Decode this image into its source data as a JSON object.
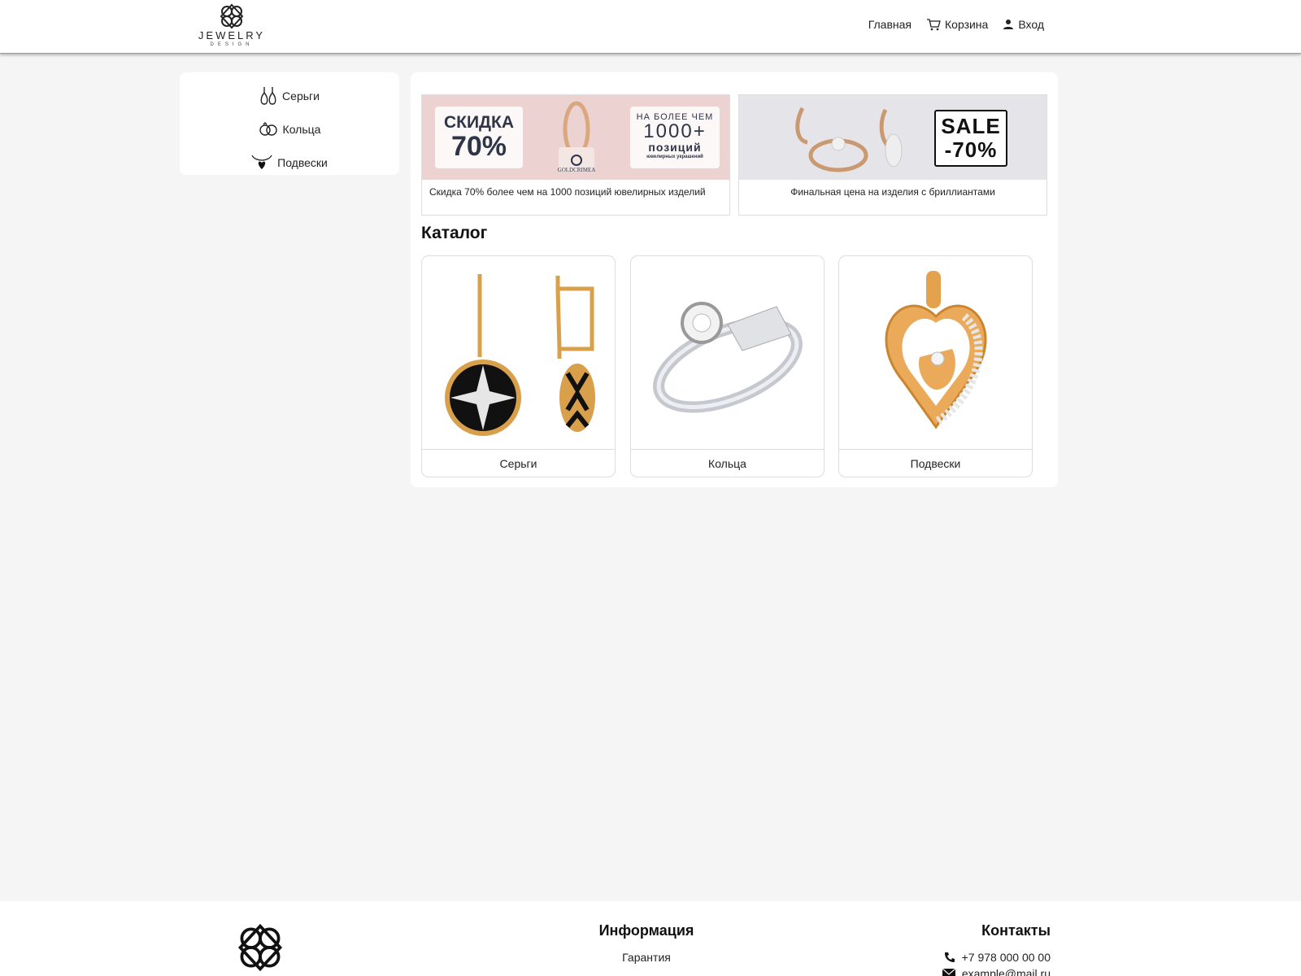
{
  "brand": {
    "name": "JEWELRY",
    "sub": "DESIGN"
  },
  "nav": {
    "home": "Главная",
    "cart": "Корзина",
    "login": "Вход"
  },
  "sidebar": {
    "items": [
      {
        "label": "Серьги",
        "icon": "earrings-icon"
      },
      {
        "label": "Кольца",
        "icon": "rings-icon"
      },
      {
        "label": "Подвески",
        "icon": "pendant-icon"
      }
    ]
  },
  "banners": [
    {
      "caption": "Скидка 70% более чем на 1000 позиций ювелирных изделий",
      "promo_left_1": "СКИДКА",
      "promo_left_2": "70%",
      "promo_right_1": "НА БОЛЕЕ ЧЕМ",
      "promo_right_2": "1000+",
      "promo_right_3": "позиций",
      "promo_right_4": "ювелирных украшений",
      "brand": "GOLDCRIMEA"
    },
    {
      "caption": "Финальная цена на изделия с бриллиантами",
      "sale_1": "SALE",
      "sale_2": "-70%"
    }
  ],
  "catalog": {
    "title": "Каталог",
    "cards": [
      {
        "label": "Серьги"
      },
      {
        "label": "Кольца"
      },
      {
        "label": "Подвески"
      }
    ]
  },
  "footer": {
    "info_title": "Информация",
    "info_links": [
      "Гарантия"
    ],
    "contacts_title": "Контакты",
    "phone": "+7 978 000 00 00",
    "email": "example@mail.ru"
  },
  "colors": {
    "accent_gold": "#d9a04c",
    "banner_pink": "#ecd2d0",
    "page_bg": "#f5f5f5"
  }
}
